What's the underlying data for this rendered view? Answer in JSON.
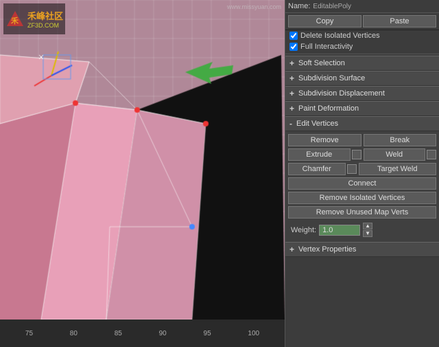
{
  "viewport": {
    "logo": {
      "line1": "禾峰社区",
      "line2": "ZF3D.COM"
    },
    "watermark": "www.missyuan.com",
    "ruler_marks": [
      "75",
      "80",
      "85",
      "90",
      "95",
      "100"
    ]
  },
  "panel": {
    "name_label": "Name:",
    "name_value": "EditablePoly",
    "copy_label": "Copy",
    "paste_label": "Paste",
    "delete_isolated": "Delete Isolated Vertices",
    "full_interactivity": "Full Interactivity",
    "sections": [
      {
        "type": "collapsed",
        "symbol": "+",
        "title": "Soft Selection"
      },
      {
        "type": "collapsed",
        "symbol": "+",
        "title": "Subdivision Surface"
      },
      {
        "type": "collapsed",
        "symbol": "+",
        "title": "Subdivision Displacement"
      },
      {
        "type": "collapsed",
        "symbol": "+",
        "title": "Paint Deformation"
      }
    ],
    "edit_vertices": {
      "title": "Edit Vertices",
      "symbol": "-",
      "remove_label": "Remove",
      "break_label": "Break",
      "extrude_label": "Extrude",
      "weld_label": "Weld",
      "chamfer_label": "Chamfer",
      "target_weld_label": "Target Weld",
      "connect_label": "Connect",
      "remove_isolated_label": "Remove Isolated Vertices",
      "remove_unused_label": "Remove Unused Map Verts",
      "weight_label": "Weight:",
      "weight_value": "1.0"
    },
    "vertex_properties": {
      "symbol": "+",
      "title": "Vertex Properties"
    }
  }
}
